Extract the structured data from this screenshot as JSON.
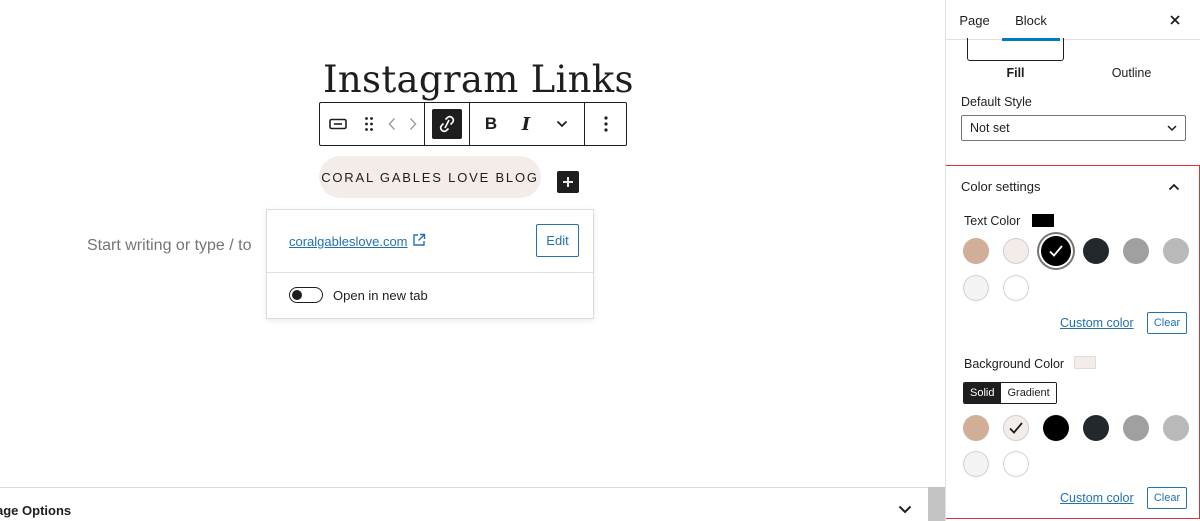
{
  "editor": {
    "page_title": "Instagram Links",
    "button_text": "CORAL GABLES LOVE BLOG",
    "placeholder": "Start writing or type / to",
    "link_popover": {
      "url": "coralgableslove.com",
      "edit_label": "Edit",
      "new_tab_label": "Open in new tab",
      "new_tab_enabled": false
    },
    "page_options_label": "age Options"
  },
  "toolbar": {
    "items": [
      "button-block-icon",
      "drag-handle-icon",
      "move-left-icon",
      "move-right-icon",
      "unlink-icon",
      "bold",
      "italic",
      "more-rich-text-icon",
      "options-icon"
    ],
    "bold_label": "B",
    "italic_label": "I"
  },
  "sidebar": {
    "tabs": [
      {
        "label": "Page",
        "active": false
      },
      {
        "label": "Block",
        "active": true
      }
    ],
    "styles": {
      "fill_label": "Fill",
      "outline_label": "Outline",
      "selected": "Fill"
    },
    "default_style": {
      "label": "Default Style",
      "value": "Not set"
    },
    "color_settings": {
      "title": "Color settings",
      "text_color": {
        "label": "Text Color",
        "current": "#000000",
        "palette": [
          "#d1ae98",
          "#f4ece8",
          "#000000",
          "#23282d",
          "#a0a0a0",
          "#b9b9b9",
          "#f3f3f3",
          "#ffffff"
        ],
        "selected_index": 2,
        "custom_label": "Custom color",
        "clear_label": "Clear"
      },
      "background_color": {
        "label": "Background Color",
        "current": "#f4ece8",
        "mode_options": [
          "Solid",
          "Gradient"
        ],
        "mode_selected": "Solid",
        "palette": [
          "#d1ae98",
          "#f4ece8",
          "#000000",
          "#23282d",
          "#a0a0a0",
          "#b9b9b9",
          "#f3f3f3",
          "#ffffff"
        ],
        "selected_index": 1,
        "custom_label": "Custom color",
        "clear_label": "Clear"
      }
    }
  },
  "colors": {
    "accent": "#007cba",
    "link": "#2271b1",
    "highlight_border": "#d63638"
  }
}
